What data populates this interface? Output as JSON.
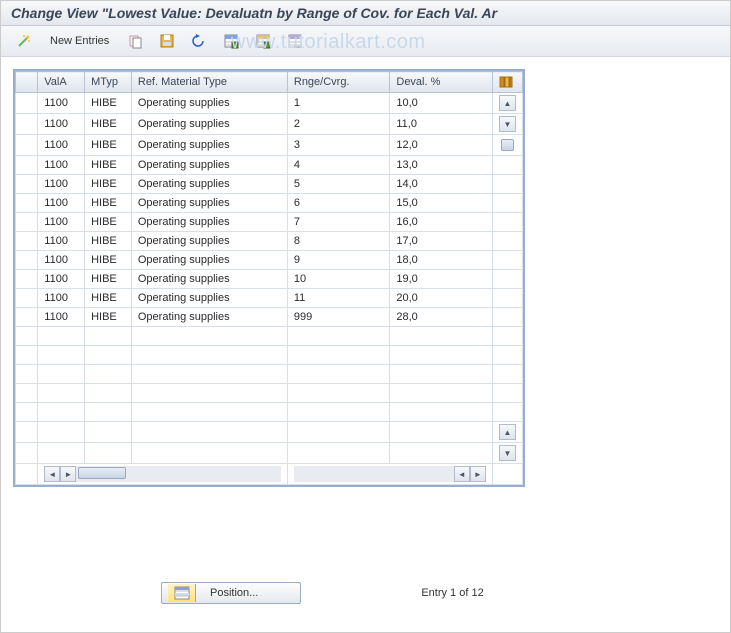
{
  "title": "Change View \"Lowest Value: Devaluatn by Range of Cov. for Each Val. Ar",
  "watermark": "www.tutorialkart.com",
  "toolbar": {
    "new_entries": "New Entries"
  },
  "columns": {
    "vala": "ValA",
    "mtyp": "MTyp",
    "ref": "Ref. Material Type",
    "rnge": "Rnge/Cvrg.",
    "deval": "Deval. %"
  },
  "rows": [
    {
      "vala": "1100",
      "mtyp": "HIBE",
      "ref": "Operating supplies",
      "rnge": "1",
      "deval": "10,0"
    },
    {
      "vala": "1100",
      "mtyp": "HIBE",
      "ref": "Operating supplies",
      "rnge": "2",
      "deval": "11,0"
    },
    {
      "vala": "1100",
      "mtyp": "HIBE",
      "ref": "Operating supplies",
      "rnge": "3",
      "deval": "12,0"
    },
    {
      "vala": "1100",
      "mtyp": "HIBE",
      "ref": "Operating supplies",
      "rnge": "4",
      "deval": "13,0"
    },
    {
      "vala": "1100",
      "mtyp": "HIBE",
      "ref": "Operating supplies",
      "rnge": "5",
      "deval": "14,0"
    },
    {
      "vala": "1100",
      "mtyp": "HIBE",
      "ref": "Operating supplies",
      "rnge": "6",
      "deval": "15,0"
    },
    {
      "vala": "1100",
      "mtyp": "HIBE",
      "ref": "Operating supplies",
      "rnge": "7",
      "deval": "16,0"
    },
    {
      "vala": "1100",
      "mtyp": "HIBE",
      "ref": "Operating supplies",
      "rnge": "8",
      "deval": "17,0"
    },
    {
      "vala": "1100",
      "mtyp": "HIBE",
      "ref": "Operating supplies",
      "rnge": "9",
      "deval": "18,0"
    },
    {
      "vala": "1100",
      "mtyp": "HIBE",
      "ref": "Operating supplies",
      "rnge": "10",
      "deval": "19,0"
    },
    {
      "vala": "1100",
      "mtyp": "HIBE",
      "ref": "Operating supplies",
      "rnge": "11",
      "deval": "20,0"
    },
    {
      "vala": "1100",
      "mtyp": "HIBE",
      "ref": "Operating supplies",
      "rnge": "999",
      "deval": "28,0"
    }
  ],
  "empty_rows": 7,
  "footer": {
    "position_label": "Position...",
    "entry_status": "Entry 1 of 12"
  }
}
